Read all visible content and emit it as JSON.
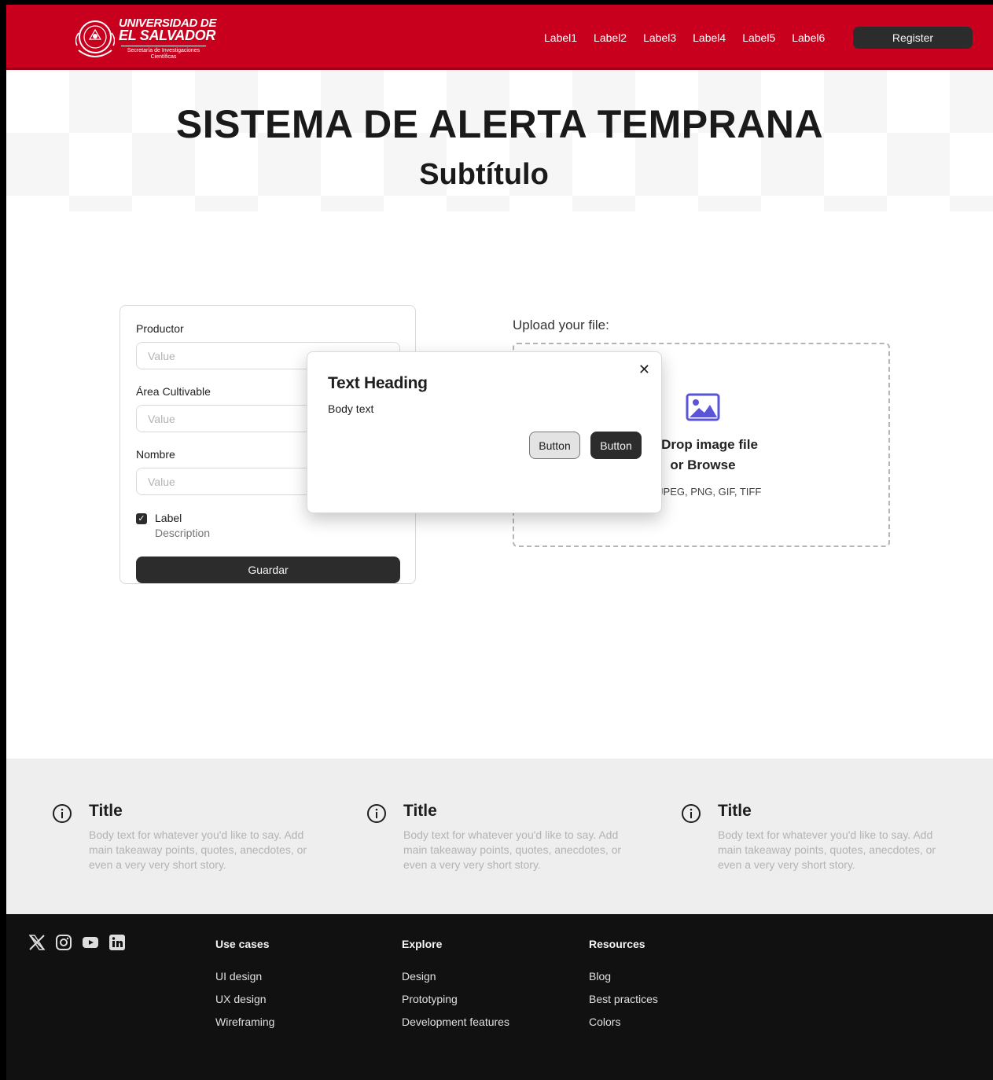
{
  "header": {
    "logo": {
      "title_line1": "UNIVERSIDAD DE",
      "title_line2": "EL SALVADOR",
      "subtitle": "Secretaría de Investigaciones Científicas"
    },
    "nav": [
      "Label1",
      "Label2",
      "Label3",
      "Label4",
      "Label5",
      "Label6"
    ],
    "register_label": "Register",
    "background_color": "#c8001e"
  },
  "hero": {
    "title": "SISTEMA DE ALERTA TEMPRANA",
    "subtitle": "Subtítulo"
  },
  "form": {
    "fields": [
      {
        "label": "Productor",
        "placeholder": "Value"
      },
      {
        "label": "Área Cultivable",
        "placeholder": "Value"
      },
      {
        "label": "Nombre",
        "placeholder": "Value"
      }
    ],
    "checkbox": {
      "label": "Label",
      "description": "Description",
      "checked": true
    },
    "submit_label": "Guardar"
  },
  "upload": {
    "title": "Upload your file:",
    "main_text": "Drag & Drop image file",
    "or_text": "or Browse",
    "formats": "Supports: JPEG, PNG, GIF, TIFF",
    "visible_main_text": "& Drop image file",
    "visible_formats": "ts: JPEG, PNG, GIF, TIFF",
    "icon": "image-icon",
    "icon_color": "#5a55d6"
  },
  "modal": {
    "heading": "Text Heading",
    "body": "Body text",
    "secondary_label": "Button",
    "primary_label": "Button",
    "close_icon": "close-icon"
  },
  "info": [
    {
      "title": "Title",
      "body": "Body text for whatever you'd like to say. Add main takeaway points, quotes, anecdotes, or even a very very short story."
    },
    {
      "title": "Title",
      "body": "Body text for whatever you'd like to say. Add main takeaway points, quotes, anecdotes, or even a very very short story."
    },
    {
      "title": "Title",
      "body": "Body text for whatever you'd like to say. Add main takeaway points, quotes, anecdotes, or even a very very short story."
    }
  ],
  "footer": {
    "social": [
      "x-icon",
      "instagram-icon",
      "youtube-icon",
      "linkedin-icon"
    ],
    "columns": [
      {
        "title": "Use cases",
        "links": [
          "UI design",
          "UX design",
          "Wireframing"
        ]
      },
      {
        "title": "Explore",
        "links": [
          "Design",
          "Prototyping",
          "Development features"
        ]
      },
      {
        "title": "Resources",
        "links": [
          "Blog",
          "Best practices",
          "Colors"
        ]
      }
    ]
  }
}
